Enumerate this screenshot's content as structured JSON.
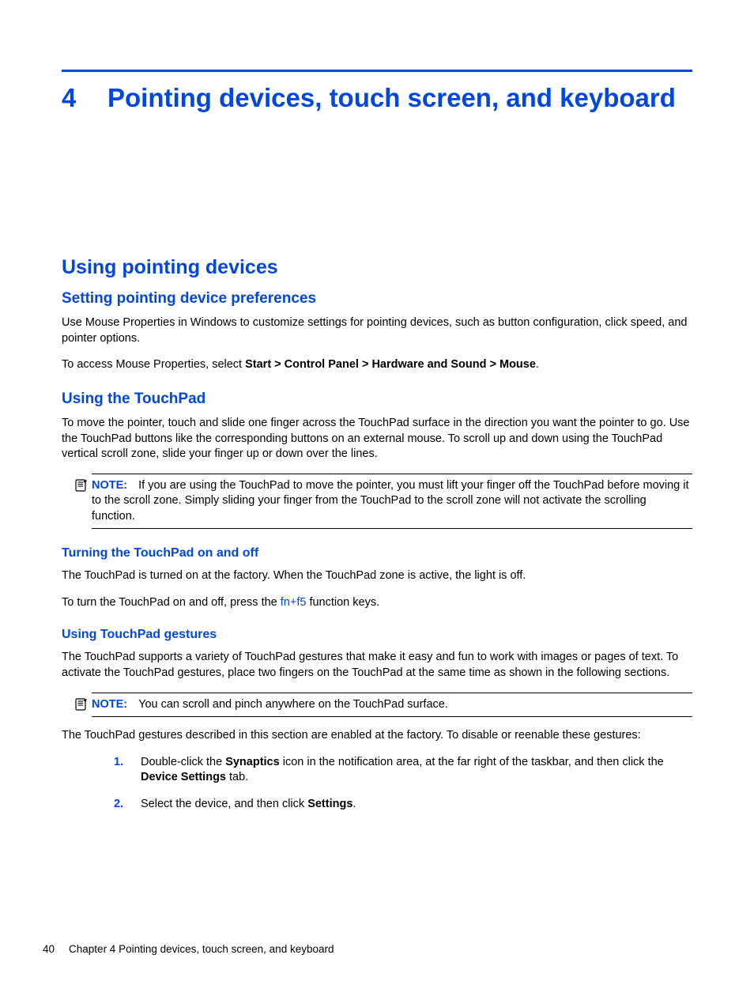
{
  "chapter": {
    "number": "4",
    "title": "Pointing devices, touch screen, and keyboard"
  },
  "section1": {
    "title": "Using pointing devices",
    "sub1": {
      "title": "Setting pointing device preferences",
      "p1": "Use Mouse Properties in Windows to customize settings for pointing devices, such as button configuration, click speed, and pointer options.",
      "p2a": "To access Mouse Properties, select ",
      "p2b": "Start > Control Panel > Hardware and Sound > Mouse",
      "p2c": "."
    },
    "sub2": {
      "title": "Using the TouchPad",
      "p1": "To move the pointer, touch and slide one finger across the TouchPad surface in the direction you want the pointer to go. Use the TouchPad buttons like the corresponding buttons on an external mouse. To scroll up and down using the TouchPad vertical scroll zone, slide your finger up or down over the lines.",
      "note1": {
        "label": "NOTE:",
        "text": "If you are using the TouchPad to move the pointer, you must lift your finger off the TouchPad before moving it to the scroll zone. Simply sliding your finger from the TouchPad to the scroll zone will not activate the scrolling function."
      },
      "subsub1": {
        "title": "Turning the TouchPad on and off",
        "p1": "The TouchPad is turned on at the factory. When the TouchPad zone is active, the light is off.",
        "p2a": "To turn the TouchPad on and off, press the ",
        "p2b": "fn+f5",
        "p2c": " function keys."
      },
      "subsub2": {
        "title": "Using TouchPad gestures",
        "p1": "The TouchPad supports a variety of TouchPad gestures that make it easy and fun to work with images or pages of text. To activate the TouchPad gestures, place two fingers on the TouchPad at the same time as shown in the following sections.",
        "note1": {
          "label": "NOTE:",
          "text": "You can scroll and pinch anywhere on the TouchPad surface."
        },
        "p2": "The TouchPad gestures described in this section are enabled at the factory. To disable or reenable these gestures:",
        "step1a": "Double-click the ",
        "step1b": "Synaptics",
        "step1c": " icon in the notification area, at the far right of the taskbar, and then click the ",
        "step1d": "Device Settings",
        "step1e": " tab.",
        "step2a": "Select the device, and then click ",
        "step2b": "Settings",
        "step2c": "."
      }
    }
  },
  "footer": {
    "page": "40",
    "text": "Chapter 4   Pointing devices, touch screen, and keyboard"
  }
}
